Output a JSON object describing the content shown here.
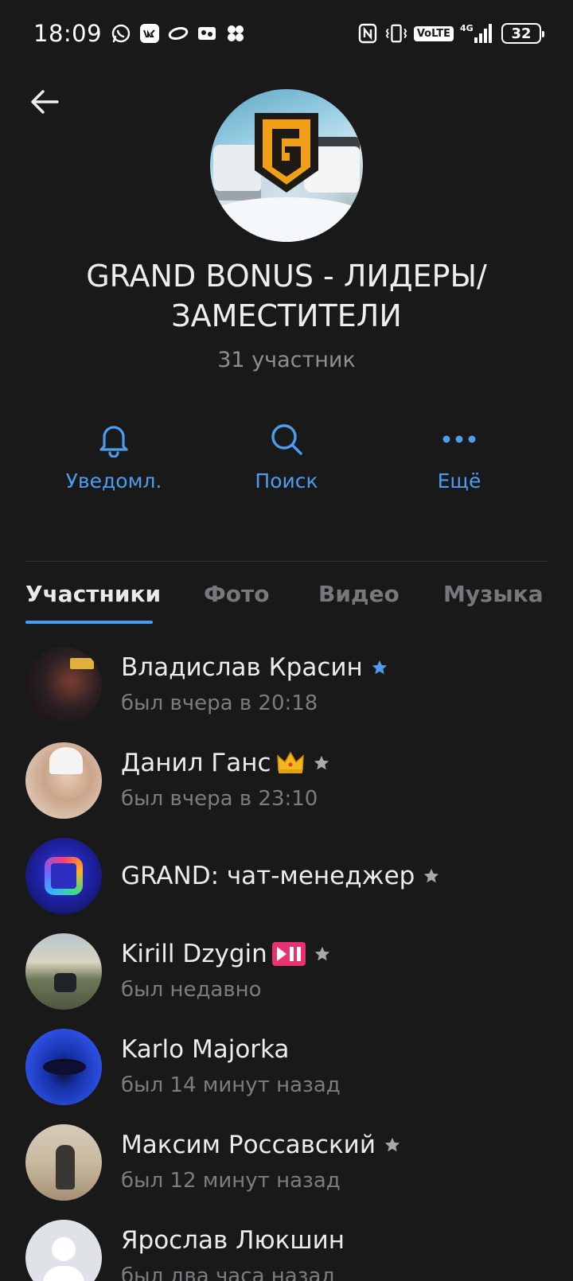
{
  "status_bar": {
    "time": "18:09",
    "app_icons": [
      "whatsapp-icon",
      "vk-icon",
      "ring-icon",
      "photo-app-icon",
      "clover-icon"
    ],
    "volte_label": "VoLTE",
    "network": "4G",
    "battery_level": "32"
  },
  "header": {
    "title": "GRAND BONUS - ЛИДЕРЫ/ ЗАМЕСТИТЕЛИ",
    "subtitle": "31 участник"
  },
  "actions": [
    {
      "label": "Уведомл.",
      "icon": "bell-icon"
    },
    {
      "label": "Поиск",
      "icon": "search-icon"
    },
    {
      "label": "Ещё",
      "icon": "more-icon"
    }
  ],
  "tabs": [
    {
      "label": "Участники",
      "active": true
    },
    {
      "label": "Фото",
      "active": false
    },
    {
      "label": "Видео",
      "active": false
    },
    {
      "label": "Музыка",
      "active": false
    }
  ],
  "members": [
    {
      "name": "Владислав Красин",
      "status": "был вчера в 20:18",
      "star": "blue"
    },
    {
      "name": "Данил Ганс",
      "emoji": "crown-emoji",
      "status": "был вчера в 23:10",
      "star": "gray"
    },
    {
      "name": "GRAND: чат-менеджер",
      "status": "",
      "star": "gray"
    },
    {
      "name": "Kirill Dzygin",
      "emoji": "play-pause-emoji",
      "status": "был недавно",
      "star": "gray"
    },
    {
      "name": "Karlo Majorka",
      "status": "был 14 минут назад"
    },
    {
      "name": "Максим Россавский",
      "status": "был 12 минут назад",
      "star": "gray"
    },
    {
      "name": "Ярослав Люкшин",
      "status": "был два часа назад"
    }
  ],
  "colors": {
    "background": "#19191a",
    "accent": "#4d9cf0",
    "secondary_text": "#7c7c80",
    "star_gray": "#a8a8ad"
  }
}
